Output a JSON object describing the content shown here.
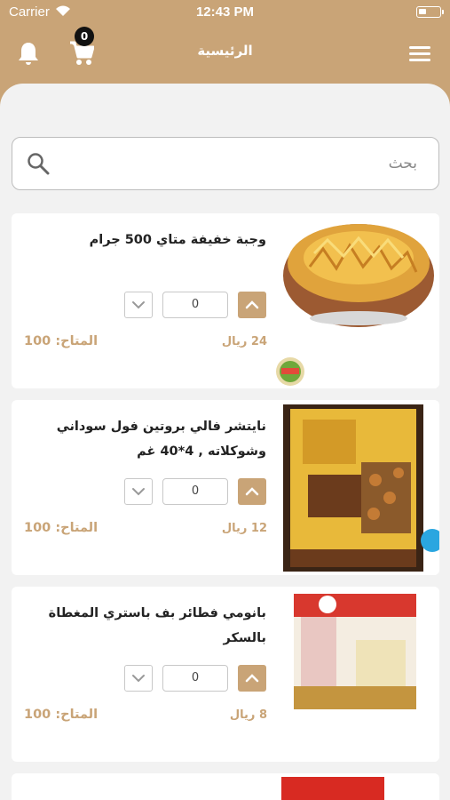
{
  "status_bar": {
    "carrier": "Carrier",
    "time": "12:43 PM"
  },
  "header": {
    "title": "الرئيسية",
    "cart_count": "0"
  },
  "search": {
    "placeholder": "بحث"
  },
  "products": [
    {
      "title": "وجبة خفيفة متاي 500 جرام",
      "quantity": "0",
      "price": "24 ريال",
      "stock_label": "المتاح:",
      "stock_value": "100"
    },
    {
      "title": "نايتشر فالي بروتين فول سوداني وشوكلاته , 4*40 غم",
      "quantity": "0",
      "price": "12 ريال",
      "stock_label": "المتاح:",
      "stock_value": "100"
    },
    {
      "title": "بانومي فطائر بف باستري المغطاة بالسكر",
      "quantity": "0",
      "price": "8 ريال",
      "stock_label": "المتاح:",
      "stock_value": "100"
    }
  ],
  "colors": {
    "brand": "#c9a477",
    "background": "#f2f2f2"
  },
  "icons": [
    "wifi-icon",
    "battery-icon",
    "bell-icon",
    "cart-icon",
    "menu-icon",
    "search-icon",
    "chevron-up-icon",
    "chevron-down-icon"
  ]
}
